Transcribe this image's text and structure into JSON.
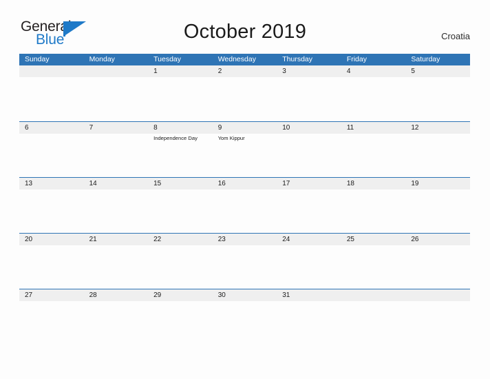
{
  "brand": {
    "name_part1": "General",
    "name_part2": "Blue",
    "flag_color": "#1f7ac8"
  },
  "header": {
    "title": "October 2019",
    "locale": "Croatia"
  },
  "colors": {
    "header_blue": "#2e74b5",
    "band_gray": "#efefef",
    "page_bg": "#fdfdfd",
    "text": "#1b1b1b"
  },
  "calendar": {
    "month": "October",
    "year": "2019",
    "weekdays": [
      "Sunday",
      "Monday",
      "Tuesday",
      "Wednesday",
      "Thursday",
      "Friday",
      "Saturday"
    ],
    "weeks": [
      {
        "days": [
          {
            "date": "",
            "event": ""
          },
          {
            "date": "",
            "event": ""
          },
          {
            "date": "1",
            "event": ""
          },
          {
            "date": "2",
            "event": ""
          },
          {
            "date": "3",
            "event": ""
          },
          {
            "date": "4",
            "event": ""
          },
          {
            "date": "5",
            "event": ""
          }
        ]
      },
      {
        "days": [
          {
            "date": "6",
            "event": ""
          },
          {
            "date": "7",
            "event": ""
          },
          {
            "date": "8",
            "event": "Independence Day"
          },
          {
            "date": "9",
            "event": "Yom Kippur"
          },
          {
            "date": "10",
            "event": ""
          },
          {
            "date": "11",
            "event": ""
          },
          {
            "date": "12",
            "event": ""
          }
        ]
      },
      {
        "days": [
          {
            "date": "13",
            "event": ""
          },
          {
            "date": "14",
            "event": ""
          },
          {
            "date": "15",
            "event": ""
          },
          {
            "date": "16",
            "event": ""
          },
          {
            "date": "17",
            "event": ""
          },
          {
            "date": "18",
            "event": ""
          },
          {
            "date": "19",
            "event": ""
          }
        ]
      },
      {
        "days": [
          {
            "date": "20",
            "event": ""
          },
          {
            "date": "21",
            "event": ""
          },
          {
            "date": "22",
            "event": ""
          },
          {
            "date": "23",
            "event": ""
          },
          {
            "date": "24",
            "event": ""
          },
          {
            "date": "25",
            "event": ""
          },
          {
            "date": "26",
            "event": ""
          }
        ]
      },
      {
        "days": [
          {
            "date": "27",
            "event": ""
          },
          {
            "date": "28",
            "event": ""
          },
          {
            "date": "29",
            "event": ""
          },
          {
            "date": "30",
            "event": ""
          },
          {
            "date": "31",
            "event": ""
          },
          {
            "date": "",
            "event": ""
          },
          {
            "date": "",
            "event": ""
          }
        ]
      }
    ]
  }
}
